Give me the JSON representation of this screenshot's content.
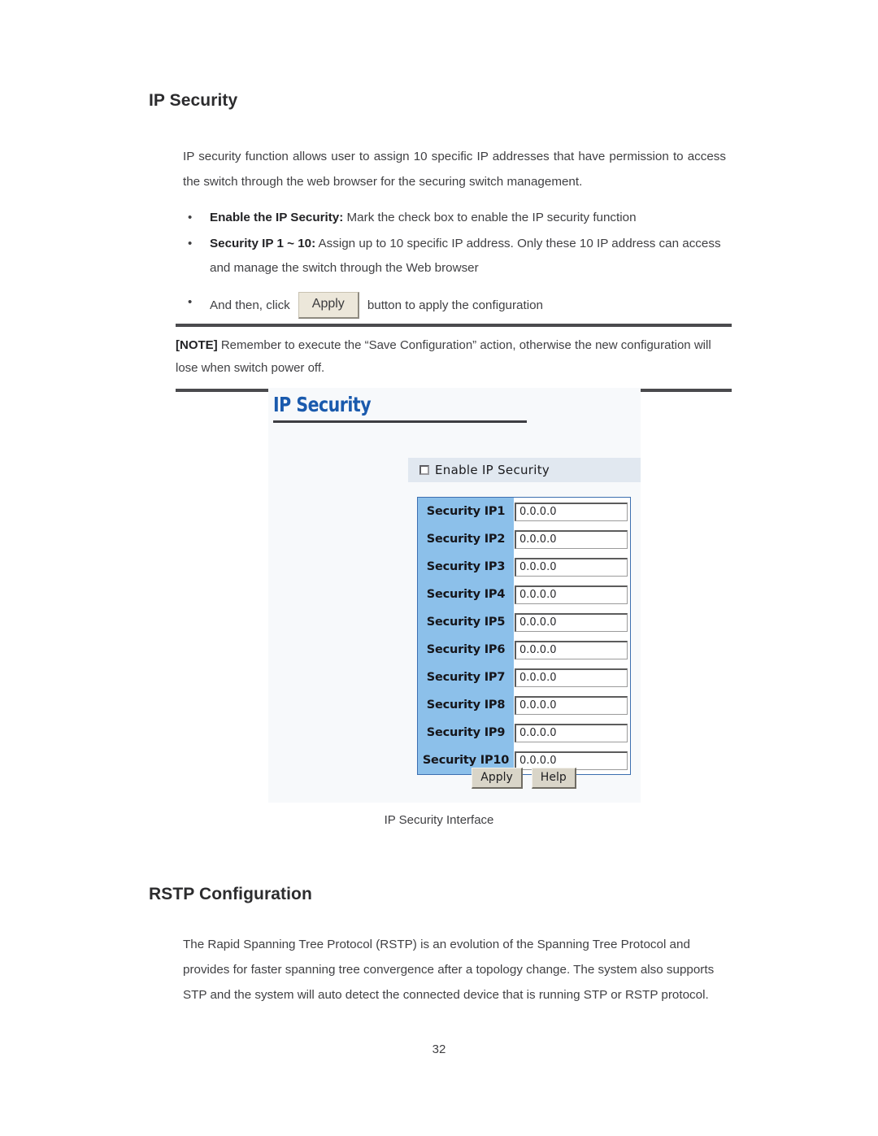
{
  "document": {
    "page_number": "32"
  },
  "sections": {
    "ip_security": {
      "heading": "IP Security",
      "intro": "IP security function allows user to assign 10 specific IP addresses that have permission to access the switch through the web browser for the securing switch management.",
      "bullets": {
        "b1_bold": "Enable the IP Security:",
        "b1_rest": " Mark the check box to enable the IP security function",
        "b2_bold": "Security IP 1 ~ 10:",
        "b2_rest": " Assign up to 10 specific IP address. Only these 10 IP address can access and manage the switch through the Web browser",
        "b3_pre": "And then, click",
        "b3_button": "Apply",
        "b3_post": "button to apply the configuration",
        "marker": "•"
      },
      "note": {
        "label": "[NOTE]",
        "text": " Remember to execute the “Save Configuration” action, otherwise the new configuration will lose when switch power off."
      },
      "figure_caption": "IP Security Interface"
    },
    "rstp": {
      "heading": "RSTP Configuration",
      "paragraph": "The Rapid Spanning Tree Protocol (RSTP) is an evolution of the Spanning Tree Protocol and provides for faster spanning tree convergence after a topology change. The system also supports STP and the system will auto detect the connected device that is running STP or RSTP protocol."
    }
  },
  "screenshot": {
    "panel_title": "IP Security",
    "enable_checkbox_label": "Enable IP Security",
    "enable_checkbox_checked": false,
    "rows": [
      {
        "label": "Security IP1",
        "value": "0.0.0.0"
      },
      {
        "label": "Security IP2",
        "value": "0.0.0.0"
      },
      {
        "label": "Security IP3",
        "value": "0.0.0.0"
      },
      {
        "label": "Security IP4",
        "value": "0.0.0.0"
      },
      {
        "label": "Security IP5",
        "value": "0.0.0.0"
      },
      {
        "label": "Security IP6",
        "value": "0.0.0.0"
      },
      {
        "label": "Security IP7",
        "value": "0.0.0.0"
      },
      {
        "label": "Security IP8",
        "value": "0.0.0.0"
      },
      {
        "label": "Security IP9",
        "value": "0.0.0.0"
      },
      {
        "label": "Security IP10",
        "value": "0.0.0.0"
      }
    ],
    "buttons": {
      "apply": "Apply",
      "help": "Help"
    },
    "colors": {
      "panel_bg": "#f7f9fb",
      "title_blue": "#1a5aad",
      "row_label_blue": "#8cc0ea",
      "table_border": "#3c6fb0",
      "enable_band": "#e1e8f0",
      "button_face": "#d9d5c8"
    }
  }
}
